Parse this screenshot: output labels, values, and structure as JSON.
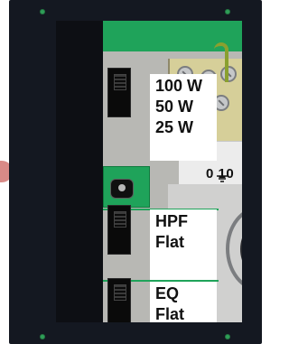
{
  "labels": {
    "power": [
      "100 W",
      "50 W",
      "25 W"
    ],
    "filter": [
      "HPF",
      "Flat"
    ],
    "eq": [
      "EQ",
      "Flat"
    ]
  },
  "terminal": {
    "strip_text": "0 10"
  },
  "icons": {
    "ground": "ground-icon",
    "screw": "screw-icon",
    "terminal-bolt": "terminal-bolt-icon"
  },
  "colors": {
    "panel": "#141821",
    "pcb_green": "#1fa35a",
    "terminal_cream": "#d6cf99",
    "blue_wire": "#1f53b8",
    "olive_wire": "#8aa02f",
    "side_knob": "#d98a87"
  }
}
